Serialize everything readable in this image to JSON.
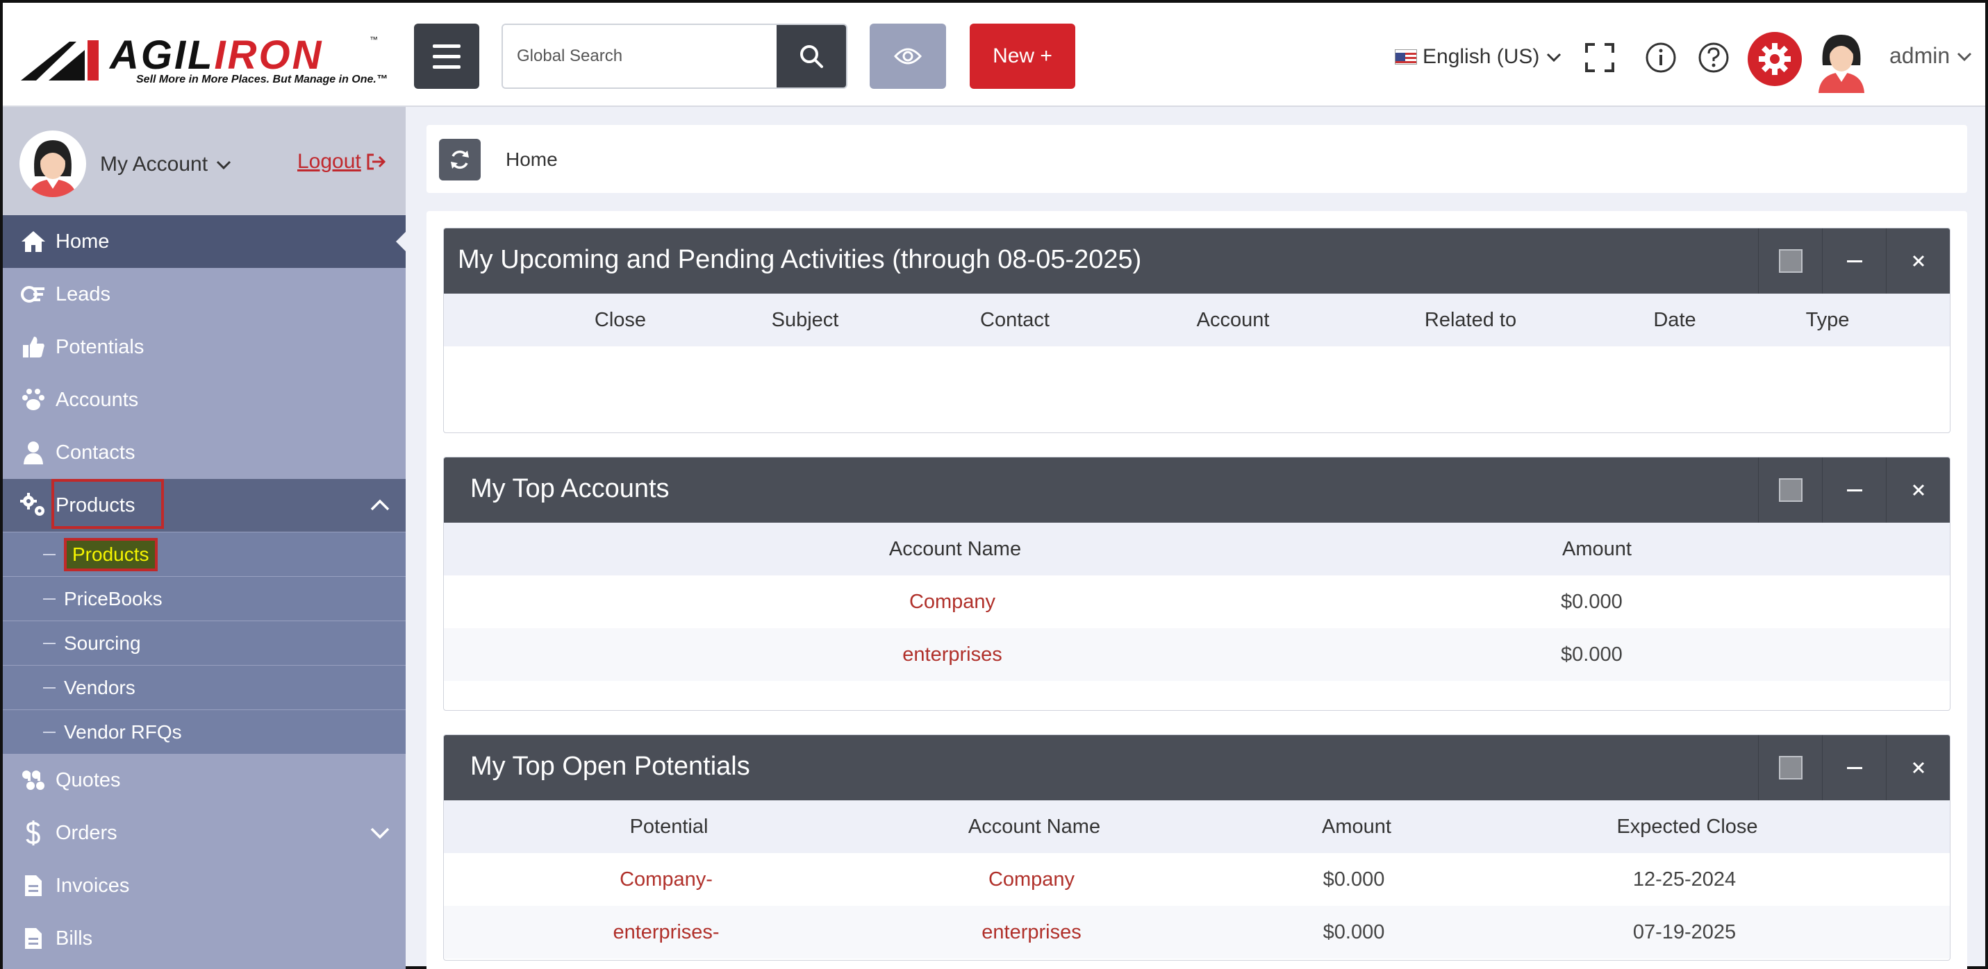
{
  "header": {
    "logo": {
      "name_part1": "AGIL",
      "name_part2": "IRON",
      "trademark": "™",
      "tagline": "Sell More in More Places. But Manage in One.™"
    },
    "search": {
      "placeholder": "Global Search"
    },
    "new_button_label": "New +",
    "language": "English (US)",
    "user": "admin",
    "colors": {
      "accent_red": "#d3232a",
      "dark": "#3c4048",
      "eye_button": "#9aa1bb"
    }
  },
  "sidebar": {
    "my_account": "My Account",
    "logout": "Logout",
    "items": [
      {
        "label": "Home",
        "icon": "home-icon"
      },
      {
        "label": "Leads",
        "icon": "leads-icon"
      },
      {
        "label": "Potentials",
        "icon": "thumbs-up-icon"
      },
      {
        "label": "Accounts",
        "icon": "paw-icon"
      },
      {
        "label": "Contacts",
        "icon": "person-icon"
      },
      {
        "label": "Products",
        "icon": "gears-icon"
      },
      {
        "label": "Quotes",
        "icon": "quote-icon"
      },
      {
        "label": "Orders",
        "icon": "dollar-icon"
      },
      {
        "label": "Invoices",
        "icon": "document-icon"
      },
      {
        "label": "Bills",
        "icon": "document-icon"
      }
    ],
    "products_sub": [
      "Products",
      "PriceBooks",
      "Sourcing",
      "Vendors",
      "Vendor RFQs"
    ]
  },
  "breadcrumb": {
    "current": "Home"
  },
  "widgets": {
    "activities": {
      "title": "My Upcoming and Pending Activities (through 08-05-2025)",
      "columns": [
        "Close",
        "Subject",
        "Contact",
        "Account",
        "Related to",
        "Date",
        "Type"
      ]
    },
    "top_accounts": {
      "title": "My Top Accounts",
      "columns": [
        "Account Name",
        "Amount"
      ],
      "rows": [
        {
          "name": "Company",
          "amount": "$0.000"
        },
        {
          "name": "enterprises",
          "amount": "$0.000"
        }
      ]
    },
    "top_potentials": {
      "title": "My Top Open Potentials",
      "columns": [
        "Potential",
        "Account Name",
        "Amount",
        "Expected Close"
      ],
      "rows": [
        {
          "potential": "Company-",
          "account": "Company",
          "amount": "$0.000",
          "close": "12-25-2024"
        },
        {
          "potential": "enterprises-",
          "account": "enterprises",
          "amount": "$0.000",
          "close": "07-19-2025"
        }
      ]
    }
  }
}
